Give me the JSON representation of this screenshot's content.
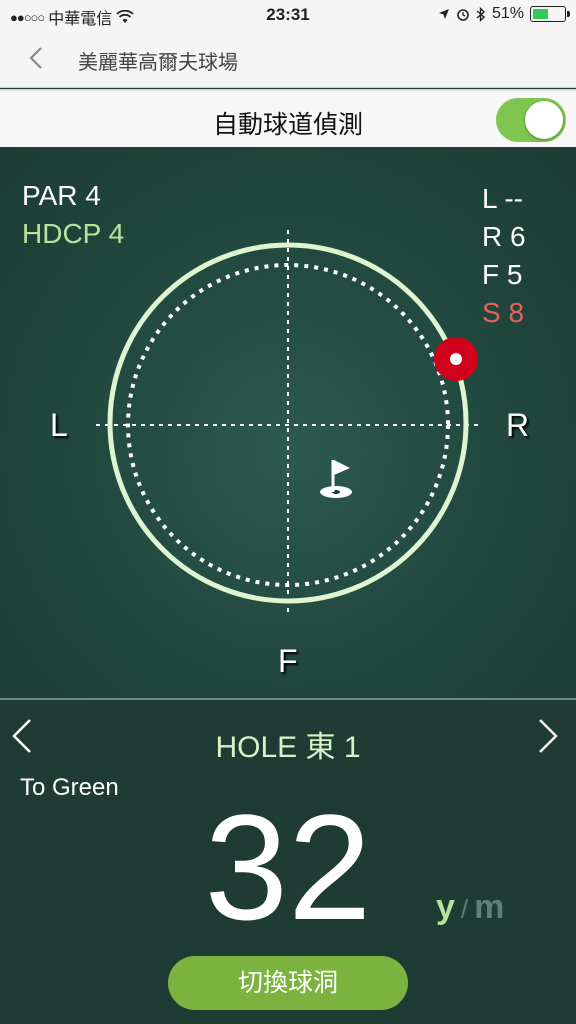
{
  "status_bar": {
    "carrier": "中華電信",
    "time": "23:31",
    "battery": "51%",
    "battery_level": 0.51,
    "battery_color": "#34c759"
  },
  "nav": {
    "title": "美麗華高爾夫球場",
    "back_icon": "chevron-left-icon"
  },
  "auto_detect": {
    "label": "自動球道偵測",
    "enabled": true,
    "toggle_color": "#7ec650"
  },
  "course_info": {
    "par": "PAR 4",
    "hdcp": "HDCP 4",
    "hdcp_color": "#b9e29a"
  },
  "directions": {
    "l": "L --",
    "r": "R 6",
    "f": "F 5",
    "s": "S 8",
    "s_color": "#e0645a"
  },
  "axes": {
    "left": "L",
    "right": "R",
    "front": "F"
  },
  "markers": {
    "target_icon": "target-marker-icon",
    "target_color": "#d0021b",
    "flag_icon": "golf-flag-icon"
  },
  "hole": {
    "title": "HOLE 東 1",
    "prev_icon": "chevron-left-icon",
    "next_icon": "chevron-right-icon"
  },
  "distance": {
    "label": "To Green",
    "value": "32",
    "unit_yard": "y",
    "unit_sep": "/",
    "unit_meter": "m",
    "active_unit": "y"
  },
  "switch_button": {
    "label": "切換球洞",
    "color": "#7cb33e"
  }
}
